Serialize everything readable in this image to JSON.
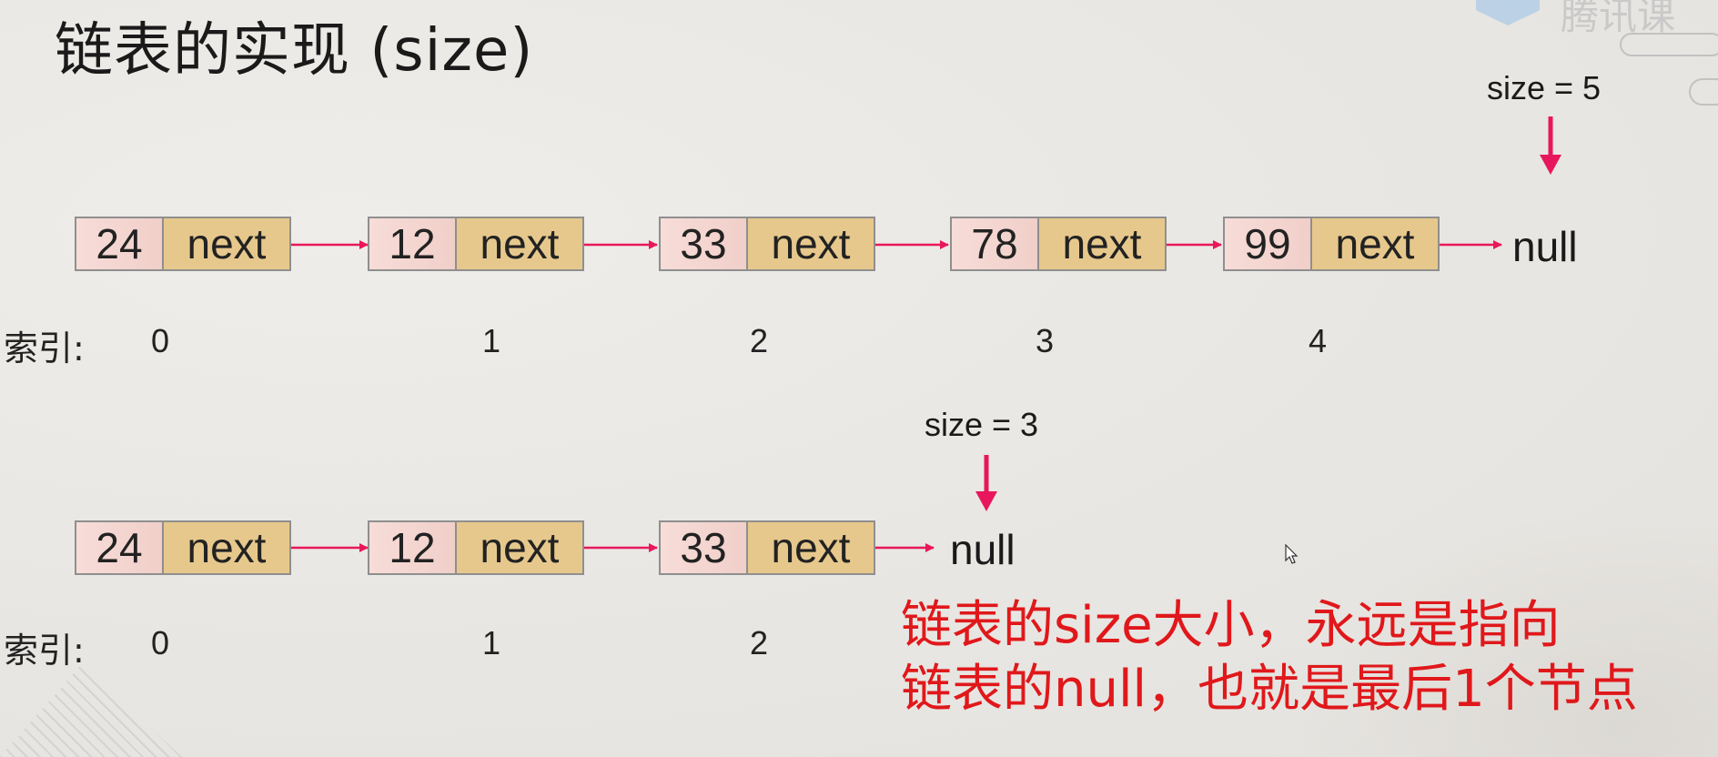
{
  "title": "链表的实现 (size)",
  "colors": {
    "arrow": "#e8175d",
    "note_text": "#e0181b",
    "value_cell": "#f4d6d2",
    "next_cell": "#e7c88c"
  },
  "list1": {
    "nodes": [
      {
        "value": "24",
        "next": "next"
      },
      {
        "value": "12",
        "next": "next"
      },
      {
        "value": "33",
        "next": "next"
      },
      {
        "value": "78",
        "next": "next"
      },
      {
        "value": "99",
        "next": "next"
      }
    ],
    "null_label": "null",
    "size_label": "size = 5",
    "index_label": "索引:",
    "indices": [
      "0",
      "1",
      "2",
      "3",
      "4"
    ]
  },
  "list2": {
    "nodes": [
      {
        "value": "24",
        "next": "next"
      },
      {
        "value": "12",
        "next": "next"
      },
      {
        "value": "33",
        "next": "next"
      }
    ],
    "null_label": "null",
    "size_label": "size = 3",
    "index_label": "索引:",
    "indices": [
      "0",
      "1",
      "2"
    ]
  },
  "note": {
    "line1": "链表的size大小，永远是指向",
    "line2": "链表的null，也就是最后1个节点"
  }
}
